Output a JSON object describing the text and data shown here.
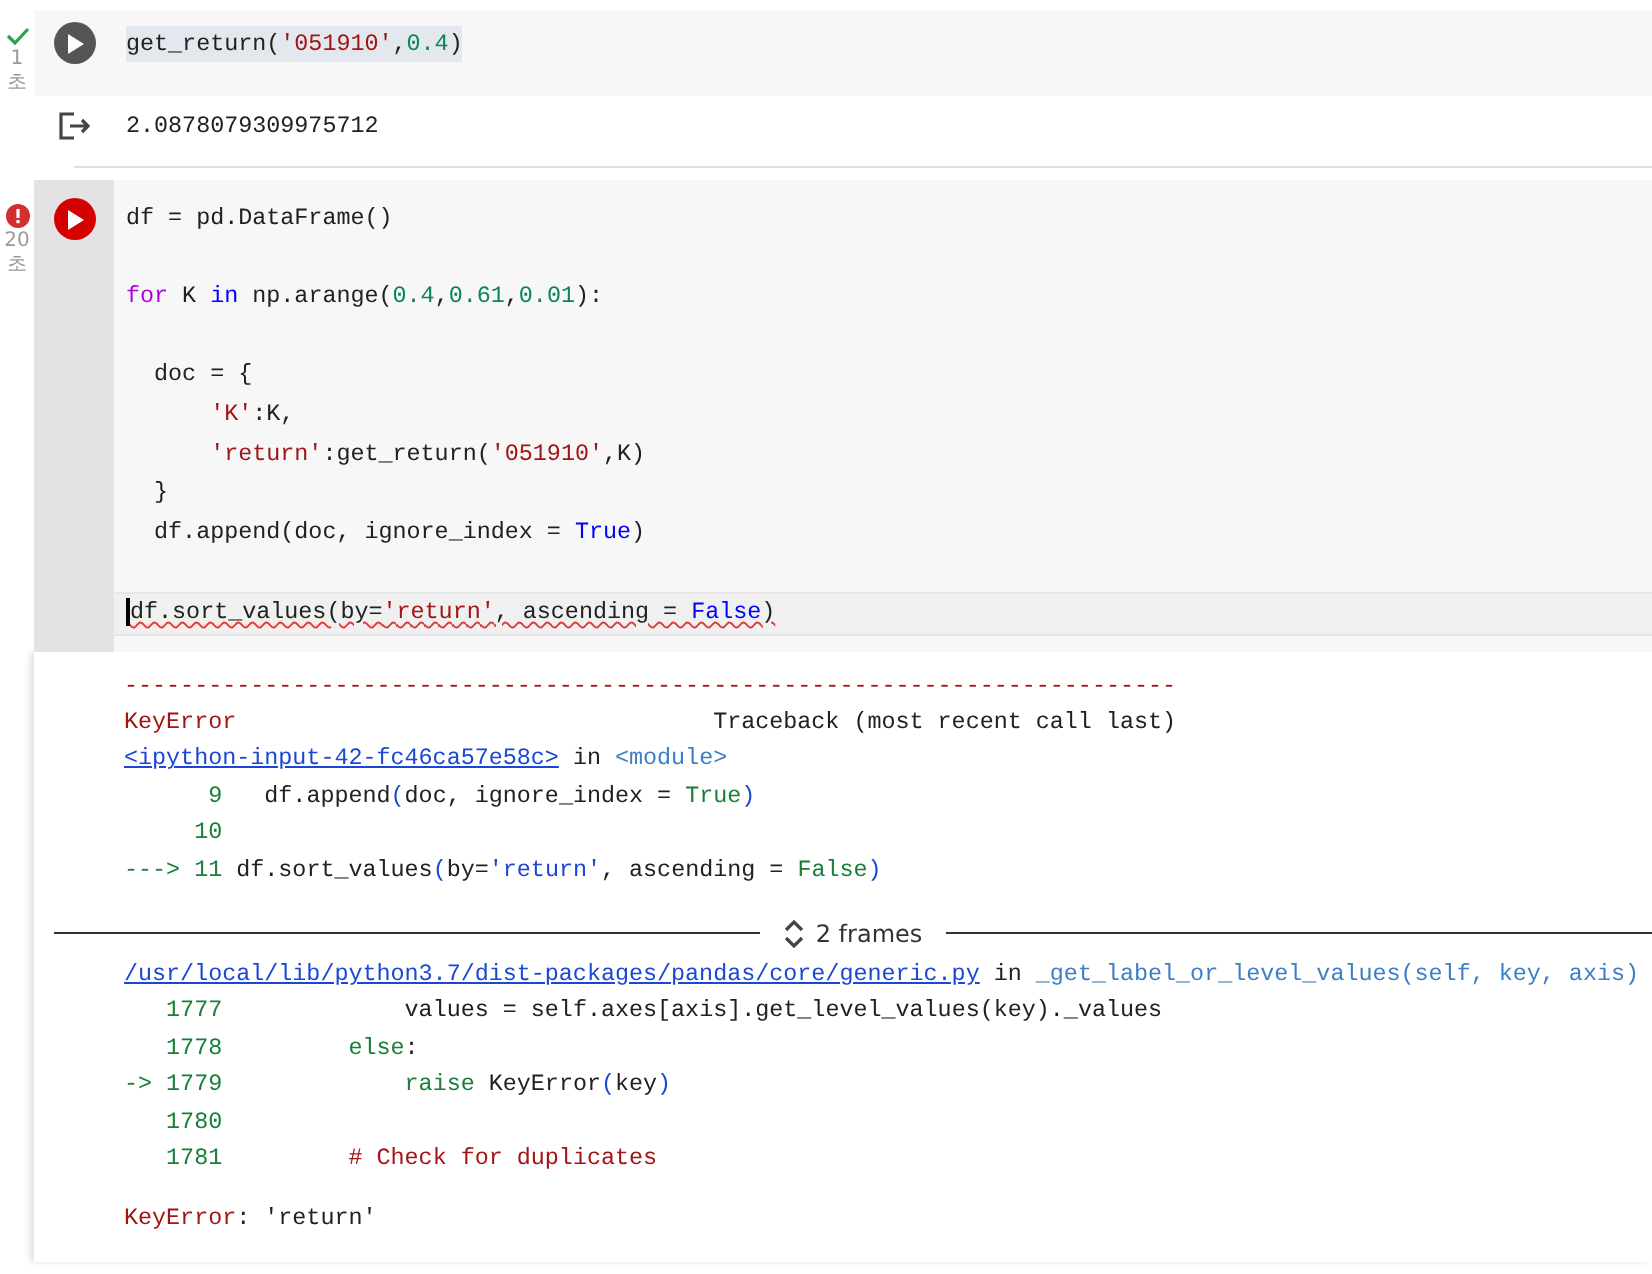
{
  "cells": [
    {
      "kind": "success",
      "time": "1초",
      "focused": false,
      "lines": [
        {
          "space_before": false,
          "highlighted": true,
          "current": false,
          "underlined": false,
          "tokens": [
            {
              "kind": "plain",
              "text": "get_return("
            },
            {
              "kind": "string",
              "text": "'051910'"
            },
            {
              "kind": "plain",
              "text": ","
            },
            {
              "kind": "number",
              "text": "0.4"
            },
            {
              "kind": "plain",
              "text": ")"
            }
          ]
        }
      ],
      "output": {
        "kind": "result",
        "text": "2.0878079309975712"
      }
    },
    {
      "kind": "error",
      "time": "20초",
      "focused": true,
      "lines": [
        {
          "space_before": false,
          "highlighted": false,
          "current": false,
          "underlined": false,
          "tokens": [
            {
              "kind": "plain",
              "text": "df = pd.DataFrame()"
            }
          ]
        },
        {
          "space_before": true,
          "highlighted": false,
          "current": false,
          "underlined": false,
          "tokens": [
            {
              "kind": "control",
              "text": "for"
            },
            {
              "kind": "plain",
              "text": " K "
            },
            {
              "kind": "keyword",
              "text": "in"
            },
            {
              "kind": "plain",
              "text": " np.arange("
            },
            {
              "kind": "number",
              "text": "0.4"
            },
            {
              "kind": "plain",
              "text": ","
            },
            {
              "kind": "number",
              "text": "0.61"
            },
            {
              "kind": "plain",
              "text": ","
            },
            {
              "kind": "number",
              "text": "0.01"
            },
            {
              "kind": "plain",
              "text": "):"
            }
          ]
        },
        {
          "space_before": true,
          "highlighted": false,
          "current": false,
          "underlined": false,
          "tokens": [
            {
              "kind": "plain",
              "text": "  doc = {"
            }
          ]
        },
        {
          "space_before": false,
          "highlighted": false,
          "current": false,
          "underlined": false,
          "tokens": [
            {
              "kind": "string",
              "text": "      'K'"
            },
            {
              "kind": "plain",
              "text": ":K,"
            }
          ]
        },
        {
          "space_before": false,
          "highlighted": false,
          "current": false,
          "underlined": false,
          "tokens": [
            {
              "kind": "string",
              "text": "      'return'"
            },
            {
              "kind": "plain",
              "text": ":get_return("
            },
            {
              "kind": "string",
              "text": "'051910'"
            },
            {
              "kind": "plain",
              "text": ",K)"
            }
          ]
        },
        {
          "space_before": false,
          "highlighted": false,
          "current": false,
          "underlined": false,
          "tokens": [
            {
              "kind": "plain",
              "text": "  }"
            }
          ]
        },
        {
          "space_before": false,
          "highlighted": false,
          "current": false,
          "underlined": false,
          "tokens": [
            {
              "kind": "plain",
              "text": "  df.append(doc, ignore_index = "
            },
            {
              "kind": "keyword",
              "text": "True"
            },
            {
              "kind": "plain",
              "text": ")"
            }
          ]
        },
        {
          "space_before": true,
          "highlighted": false,
          "current": true,
          "underlined": true,
          "tokens": [
            {
              "kind": "plain",
              "text": "df.sort_values(by="
            },
            {
              "kind": "string",
              "text": "'return'"
            },
            {
              "kind": "plain",
              "text": ", ascending = "
            },
            {
              "kind": "keyword",
              "text": "False"
            },
            {
              "kind": "plain",
              "text": ")"
            }
          ]
        }
      ],
      "output": {
        "kind": "traceback",
        "lines": [
          {
            "space_before": false,
            "tokens": [
              {
                "kind": "error",
                "text": "---------------------------------------------------------------------------"
              }
            ]
          },
          {
            "space_before": false,
            "tokens": [
              {
                "kind": "error",
                "text": "KeyError"
              },
              {
                "kind": "plain",
                "text": "                                  Traceback (most recent call last)"
              }
            ]
          },
          {
            "space_before": false,
            "tokens": [
              {
                "kind": "link",
                "text": "<ipython-input-42-fc46ca57e58c>"
              },
              {
                "kind": "plain",
                "text": " in "
              },
              {
                "kind": "module",
                "text": "<module>"
              }
            ]
          },
          {
            "space_before": false,
            "tokens": [
              {
                "kind": "lineno",
                "text": "      9"
              },
              {
                "kind": "plain",
                "text": "   df.append"
              },
              {
                "kind": "paren",
                "text": "("
              },
              {
                "kind": "plain",
                "text": "doc, ignore_index = "
              },
              {
                "kind": "green",
                "text": "True"
              },
              {
                "kind": "paren",
                "text": ")"
              }
            ]
          },
          {
            "space_before": false,
            "tokens": [
              {
                "kind": "lineno",
                "text": "     10"
              }
            ]
          },
          {
            "space_before": false,
            "tokens": [
              {
                "kind": "lineno",
                "text": "---> 11"
              },
              {
                "kind": "plain",
                "text": " df.sort_values"
              },
              {
                "kind": "paren",
                "text": "("
              },
              {
                "kind": "plain",
                "text": "by="
              },
              {
                "kind": "paren",
                "text": "'return'"
              },
              {
                "kind": "plain",
                "text": ", ascending = "
              },
              {
                "kind": "green",
                "text": "False"
              },
              {
                "kind": "paren",
                "text": ")"
              }
            ]
          },
          {
            "space_before": true,
            "kind": "frames",
            "label": "2 frames"
          },
          {
            "space_before": false,
            "tokens": [
              {
                "kind": "link",
                "text": "/usr/local/lib/python3.7/dist-packages/pandas/core/generic.py"
              },
              {
                "kind": "plain",
                "text": " in "
              },
              {
                "kind": "module",
                "text": "_get_label_or_level_values(self, key, axis)"
              }
            ]
          },
          {
            "space_before": false,
            "tokens": [
              {
                "kind": "lineno",
                "text": "   1777"
              },
              {
                "kind": "plain",
                "text": "             values = self.axes[axis].get_level_values(key)._values"
              }
            ]
          },
          {
            "space_before": false,
            "tokens": [
              {
                "kind": "lineno",
                "text": "   1778"
              },
              {
                "kind": "green",
                "text": "         else"
              },
              {
                "kind": "plain",
                "text": ":"
              }
            ]
          },
          {
            "space_before": false,
            "tokens": [
              {
                "kind": "lineno",
                "text": "-> 1779"
              },
              {
                "kind": "green",
                "text": "             raise"
              },
              {
                "kind": "plain",
                "text": " KeyError"
              },
              {
                "kind": "paren",
                "text": "("
              },
              {
                "kind": "plain",
                "text": "key"
              },
              {
                "kind": "paren",
                "text": ")"
              }
            ]
          },
          {
            "space_before": false,
            "tokens": [
              {
                "kind": "lineno",
                "text": "   1780"
              }
            ]
          },
          {
            "space_before": false,
            "tokens": [
              {
                "kind": "lineno",
                "text": "   1781"
              },
              {
                "kind": "comment",
                "text": "         # Check for duplicates"
              }
            ]
          },
          {
            "space_before": true,
            "tokens": [
              {
                "kind": "error",
                "text": "KeyError"
              },
              {
                "kind": "plain",
                "text": ": 'return'"
              }
            ]
          }
        ]
      }
    }
  ]
}
